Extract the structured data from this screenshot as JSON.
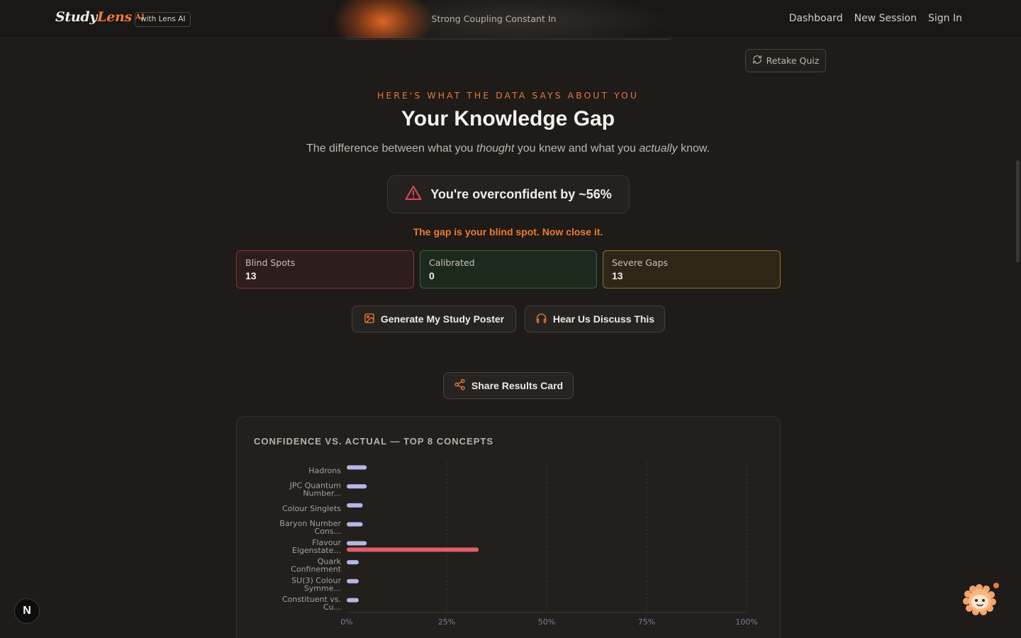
{
  "header": {
    "logo_study": "Study",
    "logo_lens": "Lens",
    "logo_ai": "AI",
    "badge": "with Lens AI",
    "session_title": "Strong Coupling Constant In",
    "nav": [
      "Dashboard",
      "New Session",
      "Sign In"
    ]
  },
  "retake_label": "Retake Quiz",
  "hero": {
    "eyebrow": "HERE'S WHAT THE DATA SAYS ABOUT YOU",
    "title": "Your Knowledge Gap",
    "sub_1": "The difference between what you ",
    "sub_thought": "thought",
    "sub_2": " you knew and what you ",
    "sub_actually": "actually",
    "sub_3": " know.",
    "verdict": "You're overconfident by ~56%",
    "tagline": "The gap is your blind spot. Now close it."
  },
  "stats": [
    {
      "label": "Blind Spots",
      "value": "13"
    },
    {
      "label": "Calibrated",
      "value": "0"
    },
    {
      "label": "Severe Gaps",
      "value": "13"
    }
  ],
  "actions": {
    "poster": "Generate My Study Poster",
    "podcast": "Hear Us Discuss This",
    "share": "Share Results Card"
  },
  "colors": {
    "accent": "#ef7a35",
    "confidence_bar": "#b3b6e6",
    "actual_bar": "#e06068"
  },
  "chart_data": {
    "type": "bar",
    "title": "CONFIDENCE VS. ACTUAL — TOP 8 CONCEPTS",
    "orientation": "horizontal",
    "categories": [
      [
        "Hadrons"
      ],
      [
        "JPC Quantum",
        "Number..."
      ],
      [
        "Colour Singlets"
      ],
      [
        "Baryon Number",
        "Cons..."
      ],
      [
        "Flavour",
        "Eigenstate..."
      ],
      [
        "Quark",
        "Confinement"
      ],
      [
        "SU(3) Colour",
        "Symme..."
      ],
      [
        "Constituent vs.",
        "Cu..."
      ]
    ],
    "series": [
      {
        "values": [
          5,
          5,
          4,
          4,
          5,
          3,
          3,
          3
        ]
      },
      {
        "values": [
          0,
          0,
          0,
          0,
          33,
          0,
          0,
          0
        ]
      }
    ],
    "xlim": [
      0,
      100
    ],
    "xticks": [
      "0%",
      "25%",
      "50%",
      "75%",
      "100%"
    ],
    "grid": true
  },
  "misc": {
    "next_badge": "N"
  }
}
